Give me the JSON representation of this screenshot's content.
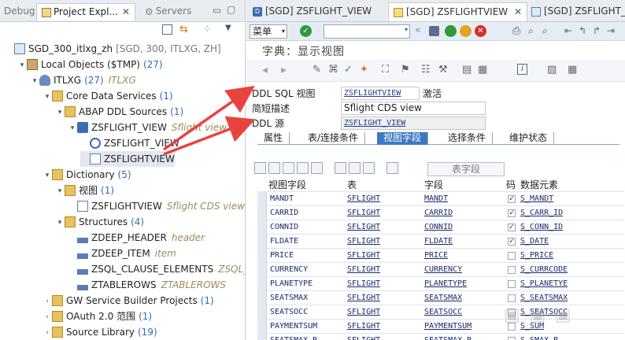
{
  "left_tabs": [
    {
      "label": "Debug",
      "icon": "debug-icon"
    },
    {
      "label": "Project Expl...",
      "icon": "project-explorer-icon"
    },
    {
      "label": "Servers",
      "icon": "servers-icon"
    }
  ],
  "tree": [
    {
      "indent": 0,
      "label": "SGD_300_itlxg_zh",
      "extra": "[SGD, 300, ITLXG, ZH]",
      "icon": "sap-project-icon",
      "tw": ""
    },
    {
      "indent": 1,
      "label": "Local Objects ($TMP)",
      "count": "(27)",
      "icon": "package-icon",
      "tw": "▾"
    },
    {
      "indent": 2,
      "label": "ITLXG",
      "count": "(27)",
      "italic": "ITLXG",
      "icon": "user-icon",
      "tw": "▾"
    },
    {
      "indent": 3,
      "label": "Core Data Services",
      "count": "(1)",
      "icon": "folder-icon",
      "tw": "▾"
    },
    {
      "indent": 4,
      "label": "ABAP DDL Sources",
      "count": "(1)",
      "icon": "folder-icon",
      "tw": "▾"
    },
    {
      "indent": 5,
      "label": "ZSFLIGHT_VIEW",
      "italic": "Sflight view",
      "icon": "ddl-source-icon",
      "tw": "▾"
    },
    {
      "indent": 6,
      "label": "ZSFLIGHT_VIEW",
      "icon": "cds-entity-icon",
      "tw": ""
    },
    {
      "indent": 6,
      "label": "ZSFLIGHTVIEW",
      "icon": "sql-view-icon",
      "tw": "",
      "selected": true
    },
    {
      "indent": 3,
      "label": "Dictionary",
      "count": "(5)",
      "icon": "folder-icon",
      "tw": "▾"
    },
    {
      "indent": 4,
      "label": "视图",
      "count": "(1)",
      "icon": "folder-icon",
      "tw": "▾"
    },
    {
      "indent": 5,
      "label": "ZSFLIGHTVIEW",
      "italic": "Sflight CDS view",
      "icon": "view-icon",
      "tw": ""
    },
    {
      "indent": 4,
      "label": "Structures",
      "count": "(4)",
      "icon": "folder-icon",
      "tw": "▾"
    },
    {
      "indent": 5,
      "label": "ZDEEP_HEADER",
      "italic": "header",
      "icon": "structure-icon",
      "tw": ""
    },
    {
      "indent": 5,
      "label": "ZDEEP_ITEM",
      "italic": "item",
      "icon": "structure-icon",
      "tw": ""
    },
    {
      "indent": 5,
      "label": "ZSQL_CLAUSE_ELEMENTS",
      "italic": "ZSQL_Cl",
      "icon": "structure-icon",
      "tw": ""
    },
    {
      "indent": 5,
      "label": "ZTABLEROWS",
      "italic": "ZTABLEROWS",
      "icon": "structure-icon",
      "tw": ""
    },
    {
      "indent": 3,
      "label": "GW Service Builder Projects",
      "count": "(1)",
      "icon": "folder-icon",
      "tw": "›"
    },
    {
      "indent": 3,
      "label": "OAuth 2.0 范围",
      "count": "(1)",
      "icon": "folder-icon",
      "tw": "›"
    },
    {
      "indent": 3,
      "label": "Source Library",
      "count": "(19)",
      "icon": "folder-icon",
      "tw": "›"
    }
  ],
  "right_tabs": [
    {
      "label": "[SGD] ZSFLIGHT_VIEW",
      "icon": "ddl-source-icon"
    },
    {
      "label": "[SGD] ZSFLIGHTVIEW",
      "icon": "sap-gui-icon",
      "active": true
    },
    {
      "label": "[SGD] ZSFLIGHT_V",
      "icon": "sap-gui-icon"
    }
  ],
  "sap": {
    "menu_label": "菜单",
    "title": "字典：显示视图"
  },
  "form": {
    "ddl_sql_view_label": "DDL SQL 视图",
    "ddl_sql_view_value": "ZSFLIGHTVIEW",
    "status": "激活",
    "short_desc_label": "简短描述",
    "short_desc_value": "Sflight CDS view",
    "ddl_source_label": "DDL 源",
    "ddl_source_value": "ZSFLIGHT_VIEW"
  },
  "sub_tabs": [
    {
      "label": "属性"
    },
    {
      "label": "表/连接条件"
    },
    {
      "label": "视图字段",
      "active": true
    },
    {
      "label": "选择条件"
    },
    {
      "label": "维护状态"
    }
  ],
  "grid": {
    "search_label": "表字段",
    "headers": {
      "view_field": "视图字段",
      "table": "表",
      "field": "字段",
      "key": "码",
      "data_element": "数据元素"
    },
    "rows": [
      {
        "view_field": "MANDT",
        "table": "SFLIGHT",
        "field": "MANDT",
        "key": "✓",
        "data_element": "S_MANDT"
      },
      {
        "view_field": "CARRID",
        "table": "SFLIGHT",
        "field": "CARRID",
        "key": "✓",
        "data_element": "S_CARR_ID"
      },
      {
        "view_field": "CONNID",
        "table": "SFLIGHT",
        "field": "CONNID",
        "key": "✓",
        "data_element": "S_CONN_ID"
      },
      {
        "view_field": "FLDATE",
        "table": "SFLIGHT",
        "field": "FLDATE",
        "key": "✓",
        "data_element": "S_DATE"
      },
      {
        "view_field": "PRICE",
        "table": "SFLIGHT",
        "field": "PRICE",
        "key": "",
        "data_element": "S_PRICE"
      },
      {
        "view_field": "CURRENCY",
        "table": "SFLIGHT",
        "field": "CURRENCY",
        "key": "",
        "data_element": "S_CURRCODE"
      },
      {
        "view_field": "PLANETYPE",
        "table": "SFLIGHT",
        "field": "PLANETYPE",
        "key": "",
        "data_element": "S_PLANETYE"
      },
      {
        "view_field": "SEATSMAX",
        "table": "SFLIGHT",
        "field": "SEATSMAX",
        "key": "",
        "data_element": "S_SEATSMAX"
      },
      {
        "view_field": "SEATSOCC",
        "table": "SFLIGHT",
        "field": "SEATSOCC",
        "key": "",
        "data_element": "S_SEATSOCC"
      },
      {
        "view_field": "PAYMENTSUM",
        "table": "SFLIGHT",
        "field": "PAYMENTSUM",
        "key": "",
        "data_element": "S_SUM"
      },
      {
        "view_field": "SEATSMAX_B",
        "table": "SFLIGHT",
        "field": "SEATSMAX_B",
        "key": "",
        "data_element": "S_SMAX_B"
      }
    ]
  },
  "colors": {
    "accent": "#3d78c4",
    "arrow": "#e8433e"
  }
}
